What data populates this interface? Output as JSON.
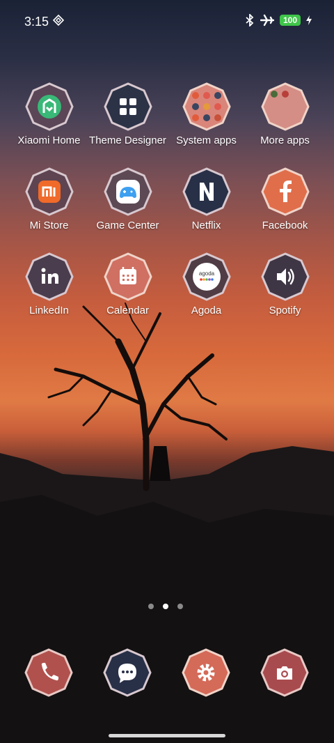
{
  "status": {
    "time": "3:15",
    "battery": "100"
  },
  "apps": [
    {
      "label": "Xiaomi Home",
      "icon": "xiaomi-home-icon"
    },
    {
      "label": "Theme Designer",
      "icon": "grid-icon"
    },
    {
      "label": "System apps",
      "icon": "folder-icon"
    },
    {
      "label": "More apps",
      "icon": "folder-icon"
    },
    {
      "label": "Mi Store",
      "icon": "mi-logo-icon"
    },
    {
      "label": "Game Center",
      "icon": "gamepad-icon"
    },
    {
      "label": "Netflix",
      "icon": "netflix-n-icon"
    },
    {
      "label": "Facebook",
      "icon": "facebook-f-icon"
    },
    {
      "label": "LinkedIn",
      "icon": "linkedin-icon"
    },
    {
      "label": "Calendar",
      "icon": "calendar-icon"
    },
    {
      "label": "Agoda",
      "icon": "agoda-icon"
    },
    {
      "label": "Spotify",
      "icon": "speaker-icon"
    }
  ],
  "agoda_logo": "agoda",
  "page_indicator": {
    "pages": 3,
    "current": 2
  },
  "dock": [
    {
      "name": "phone",
      "icon": "phone-icon"
    },
    {
      "name": "messages",
      "icon": "chat-icon"
    },
    {
      "name": "settings",
      "icon": "gear-icon"
    },
    {
      "name": "camera",
      "icon": "camera-icon"
    }
  ]
}
